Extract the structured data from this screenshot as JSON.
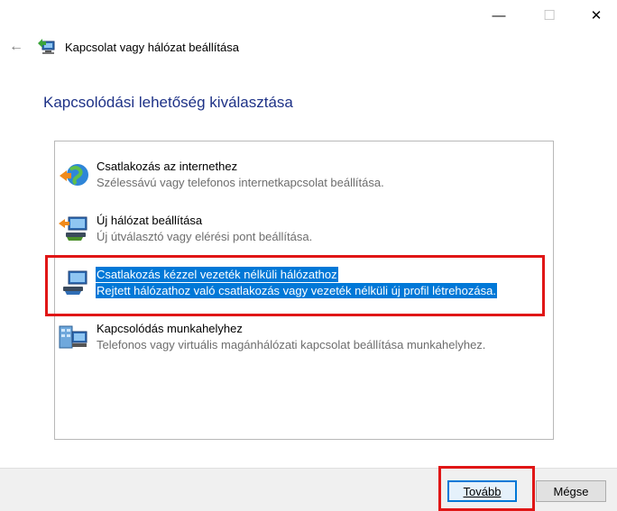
{
  "window": {
    "minimize_glyph": "—",
    "maximize_glyph": "☐",
    "close_glyph": "✕"
  },
  "nav": {
    "back_glyph": "←"
  },
  "wizard": {
    "title": "Kapcsolat vagy hálózat beállítása",
    "heading": "Kapcsolódási lehetőség kiválasztása"
  },
  "options": [
    {
      "title": "Csatlakozás az internethez",
      "desc": "Szélessávú vagy telefonos internetkapcsolat beállítása.",
      "icon": "globe-connect-icon",
      "selected": false
    },
    {
      "title": "Új hálózat beállítása",
      "desc": "Új útválasztó vagy elérési pont beállítása.",
      "icon": "network-setup-icon",
      "selected": false
    },
    {
      "title": "Csatlakozás kézzel vezeték nélküli hálózathoz",
      "desc": "Rejtett hálózathoz való csatlakozás vagy vezeték nélküli új profil létrehozása.",
      "icon": "wireless-manual-icon",
      "selected": true
    },
    {
      "title": "Kapcsolódás munkahelyhez",
      "desc": "Telefonos vagy virtuális magánhálózati kapcsolat beállítása munkahelyhez.",
      "icon": "workplace-icon",
      "selected": false
    }
  ],
  "buttons": {
    "next": "Tovább",
    "cancel": "Mégse"
  },
  "colors": {
    "selection": "#0078d7",
    "heading": "#1e3287",
    "highlight_box": "#e01616"
  }
}
